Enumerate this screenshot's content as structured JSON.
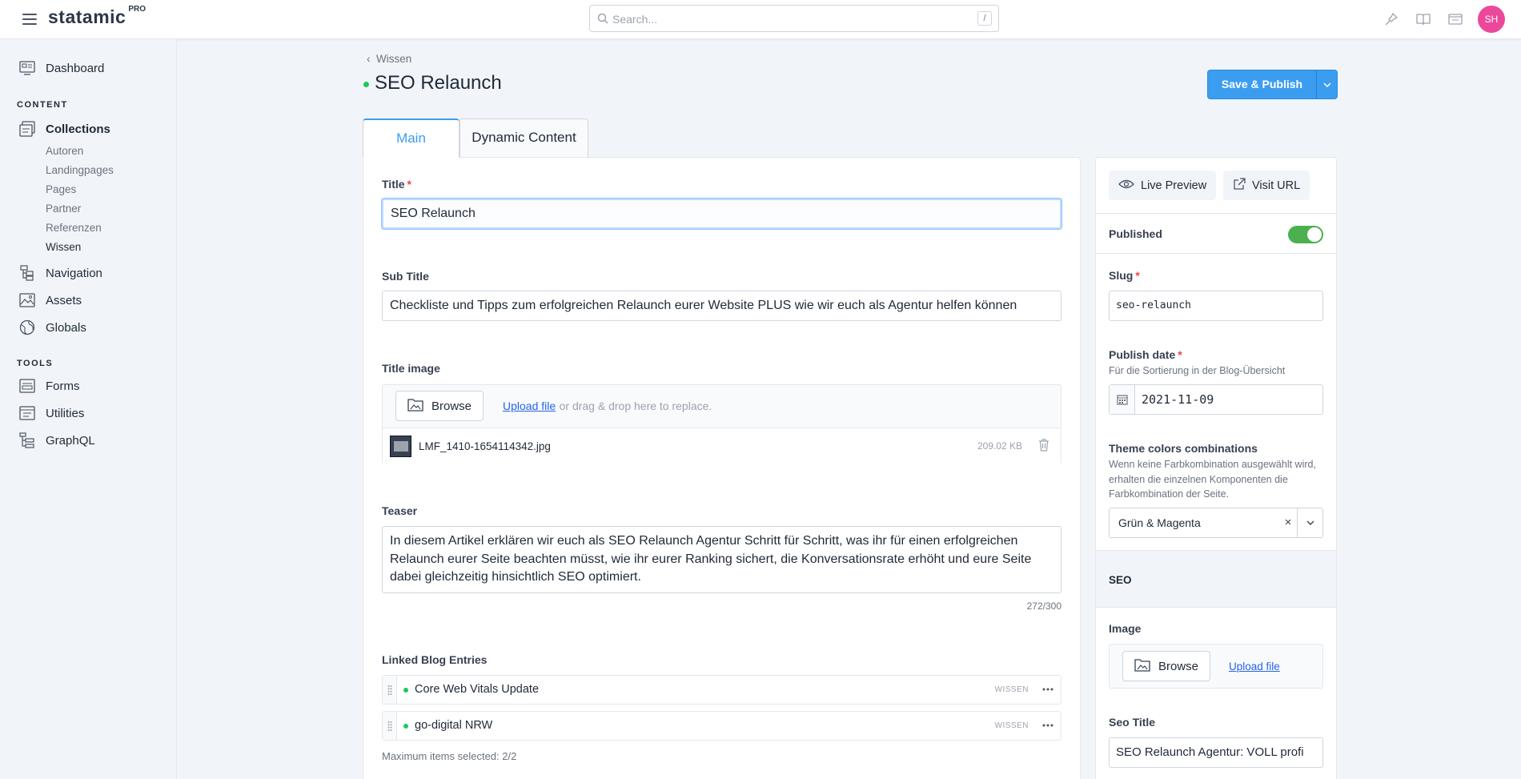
{
  "app": {
    "logo": "statamic",
    "edition": "PRO"
  },
  "search": {
    "placeholder": "Search...",
    "shortcut": "/"
  },
  "user": {
    "initials": "SH"
  },
  "sidebar": {
    "dashboard": "Dashboard",
    "content_heading": "CONTENT",
    "collections": "Collections",
    "collection_items": [
      "Autoren",
      "Landingpages",
      "Pages",
      "Partner",
      "Referenzen",
      "Wissen"
    ],
    "navigation": "Navigation",
    "assets": "Assets",
    "globals": "Globals",
    "tools_heading": "TOOLS",
    "forms": "Forms",
    "utilities": "Utilities",
    "graphql": "GraphQL"
  },
  "header": {
    "breadcrumb": "Wissen",
    "title": "SEO Relaunch",
    "save_label": "Save & Publish"
  },
  "tabs": [
    {
      "label": "Main"
    },
    {
      "label": "Dynamic Content"
    }
  ],
  "form": {
    "title_label": "Title",
    "title_value": "SEO Relaunch",
    "subtitle_label": "Sub Title",
    "subtitle_value": "Checkliste und Tipps zum erfolgreichen Relaunch eurer Website PLUS wie wir euch als Agentur helfen können",
    "title_image_label": "Title image",
    "browse_label": "Browse",
    "upload_link": "Upload file",
    "upload_hint": "or drag & drop here to replace.",
    "file_name": "LMF_1410-1654114342.jpg",
    "file_size": "209.02 KB",
    "teaser_label": "Teaser",
    "teaser_value": "In diesem Artikel erklären wir euch als SEO Relaunch Agentur Schritt für Schritt, was ihr für einen erfolgreichen Relaunch eurer Seite beachten müsst, wie ihr eurer Ranking sichert, die Konversationsrate erhöht und eure Seite dabei gleichzeitig hinsichtlich SEO optimiert.",
    "teaser_counter": "272/300",
    "linked_label": "Linked Blog Entries",
    "linked_entries": [
      {
        "title": "Core Web Vitals Update",
        "collection": "WISSEN"
      },
      {
        "title": "go-digital NRW",
        "collection": "WISSEN"
      }
    ],
    "max_items_note": "Maximum items selected: 2/2"
  },
  "side": {
    "live_preview": "Live Preview",
    "visit_url": "Visit URL",
    "published_label": "Published",
    "published": true,
    "slug_label": "Slug",
    "slug_value": "seo-relaunch",
    "publish_date_label": "Publish date",
    "publish_date_help": "Für die Sortierung in der Blog-Übersicht",
    "publish_date_value": "2021-11-09",
    "theme_label": "Theme colors combinations",
    "theme_help": "Wenn keine Farbkombination ausgewählt wird, erhalten die einzelnen Komponenten die Farbkombination der Seite.",
    "theme_value": "Grün & Magenta",
    "seo_heading": "SEO",
    "image_label": "Image",
    "browse_label": "Browse",
    "upload_link": "Upload file",
    "seo_title_label": "Seo Title",
    "seo_title_value": "SEO Relaunch Agentur: VOLL profi"
  },
  "colors": {
    "accent": "#3b9df0",
    "published": "#4caf50",
    "avatar": "#ec4899",
    "required": "#ef4444"
  }
}
